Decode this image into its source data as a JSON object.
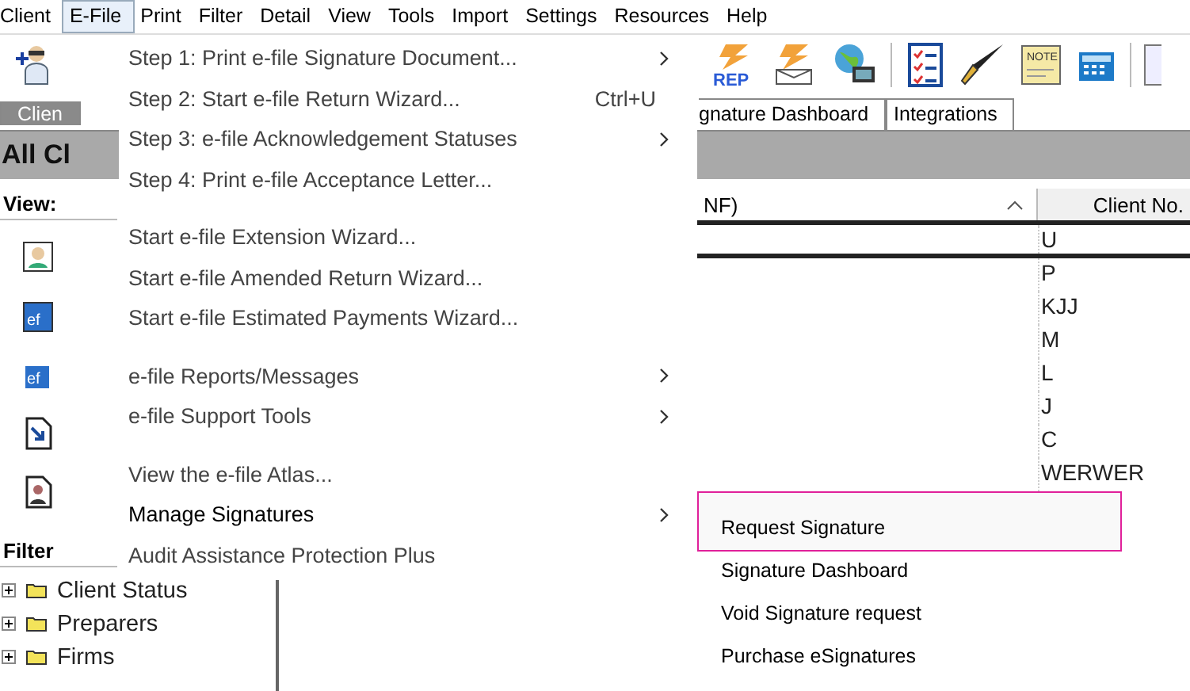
{
  "menubar": [
    {
      "label": "Client",
      "selected": false
    },
    {
      "label": "E-File",
      "selected": true
    },
    {
      "label": "Print",
      "selected": false
    },
    {
      "label": "Filter",
      "selected": false
    },
    {
      "label": "Detail",
      "selected": false
    },
    {
      "label": "View",
      "selected": false
    },
    {
      "label": "Tools",
      "selected": false
    },
    {
      "label": "Import",
      "selected": false
    },
    {
      "label": "Settings",
      "selected": false
    },
    {
      "label": "Resources",
      "selected": false
    },
    {
      "label": "Help",
      "selected": false
    }
  ],
  "tabs": [
    {
      "label": "Clien",
      "selected": true
    },
    {
      "label": "gnature Dashboard",
      "selected": false
    },
    {
      "label": "Integrations",
      "selected": false
    }
  ],
  "toolbar": {
    "rep_label": "REP",
    "note_label": "NOTE"
  },
  "band_title": "All Cl",
  "sidebar": {
    "views_label": "View:",
    "view_icon_labels": [
      "ef",
      "ef"
    ],
    "filter_label": "Filter",
    "tree": [
      {
        "label": "Client Status",
        "expanded": false
      },
      {
        "label": "Preparers",
        "expanded": false
      },
      {
        "label": "Firms",
        "expanded": false
      }
    ]
  },
  "grid": {
    "columns": [
      "NF)",
      "Client No."
    ],
    "rows": [
      {
        "client_no": "U",
        "selected": true
      },
      {
        "client_no": "P",
        "selected": false
      },
      {
        "client_no": "KJJ",
        "selected": false
      },
      {
        "client_no": "M",
        "selected": false
      },
      {
        "client_no": "L",
        "selected": false
      },
      {
        "client_no": "J",
        "selected": false
      },
      {
        "client_no": "C",
        "selected": false
      },
      {
        "client_no": "WERWER",
        "selected": false
      }
    ]
  },
  "efile_menu": {
    "groups": [
      [
        {
          "label": "Step 1: Print e-file Signature Document...",
          "submenu": true,
          "expanded": false
        },
        {
          "label": "Step 2: Start e-file Return Wizard...",
          "shortcut": "Ctrl+U",
          "submenu": false,
          "expanded": false
        },
        {
          "label": "Step 3: e-file Acknowledgement Statuses",
          "submenu": true,
          "expanded": false
        },
        {
          "label": "Step 4: Print e-file Acceptance Letter...",
          "submenu": false,
          "expanded": false
        }
      ],
      [
        {
          "label": "Start e-file Extension Wizard...",
          "submenu": false,
          "expanded": false
        },
        {
          "label": "Start e-file Amended Return Wizard...",
          "submenu": false,
          "expanded": false
        },
        {
          "label": "Start e-file Estimated Payments Wizard...",
          "submenu": false,
          "expanded": false
        }
      ],
      [
        {
          "label": "e-file Reports/Messages",
          "submenu": true,
          "expanded": false
        },
        {
          "label": "e-file Support Tools",
          "submenu": true,
          "expanded": false
        }
      ],
      [
        {
          "label": "View the e-file Atlas...",
          "submenu": false,
          "expanded": false
        },
        {
          "label": "Manage Signatures",
          "submenu": true,
          "expanded": true
        },
        {
          "label": "Audit Assistance Protection Plus",
          "submenu": false,
          "expanded": false
        }
      ]
    ]
  },
  "signatures_menu": [
    {
      "label": "Request Signature",
      "selected": true
    },
    {
      "label": "Signature Dashboard",
      "selected": false
    },
    {
      "label": "Void Signature request",
      "selected": false
    },
    {
      "label": "Purchase eSignatures",
      "selected": false
    }
  ]
}
